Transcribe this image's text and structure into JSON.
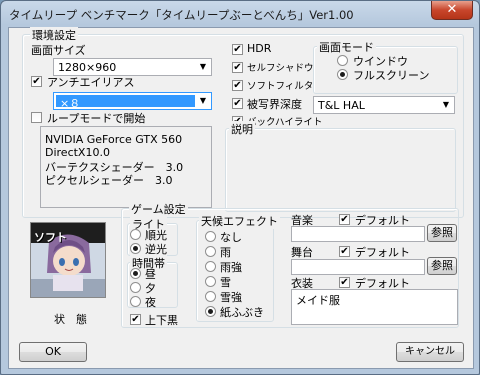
{
  "window": {
    "title": "タイムリープ ベンチマーク「タイムリープぶーとべんち」Ver1.00",
    "close_glyph": "✕"
  },
  "env": {
    "group_title": "環境設定",
    "screen_size_label": "画面サイズ",
    "screen_size_value": "1280×960",
    "antialias_label": "アンチエイリアス",
    "antialias_checked": true,
    "antialias_value": "×８",
    "loop_label": "ループモードで開始",
    "loop_checked": false,
    "info_lines": [
      "NVIDIA GeForce GTX 560",
      "DirectX10.0",
      "バーテクスシェーダー　3.0",
      "ピクセルシェーダー　3.0"
    ],
    "hdr_label": "HDR",
    "self_shadow_label": "セルフシャドウ",
    "soft_filter_label": "ソフトフィルタ",
    "dof_label": "被写界深度",
    "backlight_label": "バックハイライト",
    "renderer_value": "T&L HAL",
    "description_title": "説明",
    "screen_mode_title": "画面モード",
    "window_label": "ウインドウ",
    "fullscreen_label": "フルスクリーン",
    "fullscreen_selected": true
  },
  "game": {
    "group_title": "ゲーム設定",
    "status_label": "状　態",
    "preview_text": "ソフト",
    "light_title": "ライト",
    "front_light": "順光",
    "back_light": "逆光",
    "time_title": "時間帯",
    "time_day": "昼",
    "time_evening": "夕",
    "time_night": "夜",
    "letterbox_label": "上下黒",
    "weather_title": "天候エフェクト",
    "weather": [
      "なし",
      "雨",
      "雨強",
      "雪",
      "雪強",
      "紙ふぶき"
    ],
    "music_label": "音楽",
    "stage_label": "舞台",
    "costume_label": "衣装",
    "default_label": "デフォルト",
    "browse_label": "参照",
    "costume_value": "メイド服"
  },
  "buttons": {
    "ok": "OK",
    "cancel": "キャンセル"
  },
  "colors": {
    "select_highlight": "#3399ff",
    "title_bar": "#b9cbe0"
  },
  "icons": {
    "checkmark": "✔",
    "dropdown": "▼"
  }
}
